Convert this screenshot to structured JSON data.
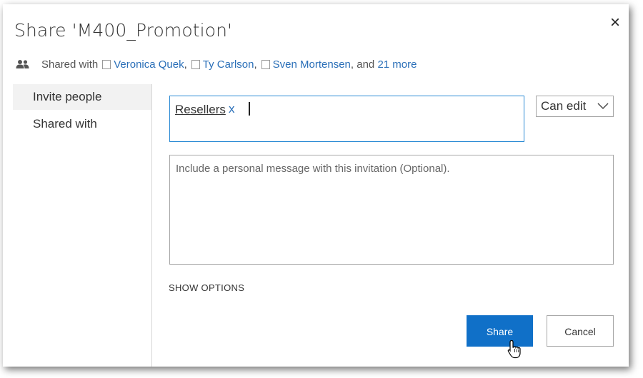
{
  "dialog": {
    "title": "Share 'M400_Promotion'",
    "close_label": "×"
  },
  "shared_with": {
    "label": "Shared with",
    "people": [
      "Veronica Quek",
      "Ty Carlson",
      "Sven Mortensen"
    ],
    "separator_comma": ",",
    "and_text": ", and",
    "more_link": "21 more"
  },
  "nav": {
    "items": [
      {
        "label": "Invite people",
        "active": true
      },
      {
        "label": "Shared with",
        "active": false
      }
    ]
  },
  "invite": {
    "token_label": "Resellers",
    "token_remove": "x"
  },
  "permission": {
    "selected": "Can edit"
  },
  "message": {
    "placeholder": "Include a personal message with this invitation (Optional)."
  },
  "options": {
    "show_options_label": "SHOW OPTIONS"
  },
  "buttons": {
    "share_label": "Share",
    "cancel_label": "Cancel"
  },
  "colors": {
    "accent": "#1070c8",
    "link": "#2a6fb8",
    "focus_border": "#2a8ad4"
  }
}
